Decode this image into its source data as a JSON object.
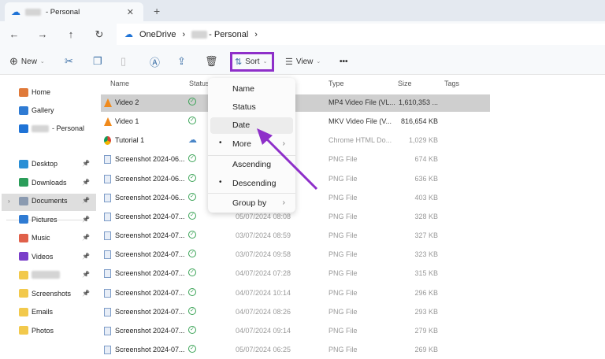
{
  "tab": {
    "title": "- Personal",
    "close": "✕",
    "new_tab": "+"
  },
  "nav": {
    "back": "←",
    "forward": "→",
    "up": "↑",
    "refresh": "↻",
    "breadcrumb": [
      "OneDrive",
      "- Personal"
    ],
    "sep": "›"
  },
  "toolbar": {
    "new": "New",
    "sort": "Sort",
    "view": "View",
    "more": "•••"
  },
  "columns": {
    "name": "Name",
    "status": "Status",
    "type": "Type",
    "size": "Size",
    "tags": "Tags"
  },
  "sidebar": {
    "top": [
      {
        "label": "Home",
        "color": "#e07a3a"
      },
      {
        "label": "Gallery",
        "color": "#2f7bd3"
      },
      {
        "label": "- Personal",
        "color": "#1f73d6"
      }
    ],
    "pinned": [
      {
        "label": "Desktop",
        "color": "#2a8fd6"
      },
      {
        "label": "Downloads",
        "color": "#2b9d5a"
      },
      {
        "label": "Documents",
        "color": "#8a9ab0"
      },
      {
        "label": "Pictures",
        "color": "#2f7bd3"
      },
      {
        "label": "Music",
        "color": "#e0604a"
      },
      {
        "label": "Videos",
        "color": "#7a3fc9"
      },
      {
        "label": "",
        "color": "#f2c94c"
      },
      {
        "label": "Screenshots",
        "color": "#f2c94c"
      },
      {
        "label": "Emails",
        "color": "#f2c94c"
      },
      {
        "label": "Photos",
        "color": "#f2c94c"
      }
    ]
  },
  "files": [
    {
      "name": "Video 2",
      "kind": "vlc",
      "status": "synced",
      "date": "",
      "type": "MP4 Video File (VL...",
      "size": "1,610,353 ..."
    },
    {
      "name": "Video 1",
      "kind": "vlc",
      "status": "synced",
      "date": "",
      "type": "MKV Video File (V...",
      "size": "816,654 KB"
    },
    {
      "name": "Tutorial 1",
      "kind": "chrome",
      "status": "cloud",
      "date": "",
      "type": "Chrome HTML Do...",
      "size": "1,029 KB"
    },
    {
      "name": "Screenshot 2024-06...",
      "kind": "png",
      "status": "synced",
      "date": "",
      "type": "PNG File",
      "size": "674 KB"
    },
    {
      "name": "Screenshot 2024-06...",
      "kind": "png",
      "status": "synced",
      "date": "",
      "type": "PNG File",
      "size": "636 KB"
    },
    {
      "name": "Screenshot 2024-06...",
      "kind": "png",
      "status": "synced",
      "date": "",
      "type": "PNG File",
      "size": "403 KB"
    },
    {
      "name": "Screenshot 2024-07...",
      "kind": "png",
      "status": "synced",
      "date": "05/07/2024 08:08",
      "type": "PNG File",
      "size": "328 KB"
    },
    {
      "name": "Screenshot 2024-07...",
      "kind": "png",
      "status": "synced",
      "date": "03/07/2024 08:59",
      "type": "PNG File",
      "size": "327 KB"
    },
    {
      "name": "Screenshot 2024-07...",
      "kind": "png",
      "status": "synced",
      "date": "03/07/2024 09:58",
      "type": "PNG File",
      "size": "323 KB"
    },
    {
      "name": "Screenshot 2024-07...",
      "kind": "png",
      "status": "synced",
      "date": "04/07/2024 07:28",
      "type": "PNG File",
      "size": "315 KB"
    },
    {
      "name": "Screenshot 2024-07...",
      "kind": "png",
      "status": "synced",
      "date": "04/07/2024 10:14",
      "type": "PNG File",
      "size": "296 KB"
    },
    {
      "name": "Screenshot 2024-07...",
      "kind": "png",
      "status": "synced",
      "date": "04/07/2024 08:26",
      "type": "PNG File",
      "size": "293 KB"
    },
    {
      "name": "Screenshot 2024-07...",
      "kind": "png",
      "status": "synced",
      "date": "04/07/2024 09:14",
      "type": "PNG File",
      "size": "279 KB"
    },
    {
      "name": "Screenshot 2024-07...",
      "kind": "png",
      "status": "synced",
      "date": "05/07/2024 06:25",
      "type": "PNG File",
      "size": "269 KB"
    }
  ],
  "sort_menu": {
    "items": [
      "Name",
      "Status",
      "Date",
      "More",
      "Ascending",
      "Descending",
      "Group by"
    ],
    "highlighted": "Date",
    "selected": [
      "More",
      "Descending"
    ]
  },
  "accent": "#8e2fc9"
}
